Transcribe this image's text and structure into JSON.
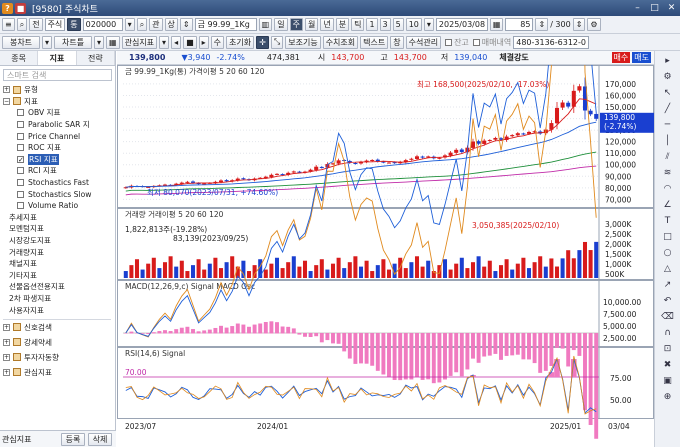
{
  "window": {
    "title": "[9580] 주식차트"
  },
  "toolbar1": {
    "jeon": "전",
    "stock_type": "주식",
    "stock_sel": "통",
    "code": "020000",
    "gwan": "관",
    "sangja": "상",
    "name": "금 99.99_1Kg",
    "il": "일",
    "ju": "주",
    "wol": "월",
    "nyeon": "년",
    "bun": "분",
    "tik": "틱",
    "n1": "1",
    "n3": "3",
    "n5": "5",
    "n10": "10",
    "date": "2025/03/08",
    "count": "85",
    "total": "/ 300"
  },
  "toolbar2": {
    "bongchart": "봉차트",
    "chartteul": "차트틀",
    "gwansim": "관심지표",
    "su": "수",
    "chogihwa": "초기화",
    "bojo": "보조기능",
    "suchi": "수치조회",
    "text": "텍스트",
    "chang": "창",
    "suseok": "수석관리",
    "jango": "잔고",
    "maemae": "매매내역",
    "account": "480-3136-6312-0"
  },
  "left": {
    "tabs": [
      "종목",
      "지표",
      "전략"
    ],
    "search_placeholder": "스마트 검색",
    "groups_top": [
      {
        "label": "유형"
      },
      {
        "label": "지표"
      }
    ],
    "indicators": [
      {
        "label": "OBV 지표",
        "checked": false
      },
      {
        "label": "Parabolic SAR 지",
        "checked": false
      },
      {
        "label": "Price Channel",
        "checked": false
      },
      {
        "label": "ROC 지표",
        "checked": false
      },
      {
        "label": "RSI 지표",
        "checked": true
      },
      {
        "label": "RCI 지표",
        "checked": false
      },
      {
        "label": "Stochastics Fast",
        "checked": false
      },
      {
        "label": "Stochastics Slow",
        "checked": false
      },
      {
        "label": "Volume Ratio",
        "checked": false
      }
    ],
    "sub_items": [
      "추세지표",
      "모멘텀지표",
      "시장강도지표",
      "거래량지표",
      "채널지표",
      "기타지표",
      "선물옵션전용지표",
      "2차 파생지표",
      "사용자지표"
    ],
    "groups_bottom": [
      "신호검색",
      "강세약세",
      "투자자동향",
      "관심지표"
    ],
    "footer": {
      "label": "관심지표",
      "add": "등록",
      "del": "삭제"
    }
  },
  "info": {
    "price": "139,800",
    "change": "▼3,940",
    "rate": "-2.74%",
    "volume": "474,381",
    "open_label": "시",
    "open": "143,700",
    "high_label": "고",
    "high": "143,700",
    "low_label": "저",
    "low": "139,040",
    "strength_label": "체결강도",
    "strength": "",
    "buy": "매수",
    "sell": "매도"
  },
  "chart_data": [
    {
      "type": "candlestick",
      "legend": "금 99.99_1Kg(통) 가격이평 5 20 60 120",
      "x": [
        "2023/07",
        "2024/01",
        "2025/01"
      ],
      "yticks": [
        170000,
        160000,
        150000,
        140000,
        130000,
        120000,
        110000,
        100000,
        90000,
        80000,
        70000
      ],
      "ylim": [
        66000,
        176000
      ],
      "max_annotation": "최고 168,500(2025/02/10, -17.03%)",
      "min_annotation": "최저 80,070(2023/07/31, +74.60%)",
      "current": "139,800",
      "current_rate": "(-2.74%)",
      "close_weekly": [
        80500,
        81800,
        81200,
        81000,
        80800,
        81500,
        82200,
        82800,
        82500,
        83600,
        84500,
        85200,
        84300,
        83300,
        83800,
        84300,
        85200,
        86400,
        85700,
        86600,
        88000,
        87700,
        86800,
        88000,
        88700,
        89600,
        91300,
        92100,
        91500,
        93000,
        94200,
        93300,
        94000,
        95700,
        98300,
        97400,
        100600,
        101200,
        103800,
        103400,
        101700,
        100800,
        102500,
        103600,
        104100,
        102900,
        102000,
        101900,
        101500,
        102500,
        104000,
        105200,
        107300,
        106200,
        107200,
        105600,
        106000,
        108100,
        110500,
        112900,
        111000,
        114800,
        120100,
        118200,
        120900,
        121400,
        123200,
        121600,
        124400,
        125700,
        127300,
        126500,
        128400,
        129000,
        127000,
        130500,
        136100,
        149200,
        153900,
        150400,
        164000,
        168000,
        147000,
        143700,
        139800
      ]
    },
    {
      "type": "bar",
      "legend": "거래량 거래이평 5 20 60 120",
      "max_annotation": "3,050,385(2025/02/10)",
      "min_annotation": "1,822,813주(-19.28%)",
      "min2_annotation": "83,139(2023/09/25)",
      "yticks": [
        "3,000K",
        "2,500K",
        "2,000K",
        "1,500K",
        "1,000K",
        "500K"
      ]
    },
    {
      "type": "line",
      "legend": "MACD(12,26,9,c) Signal MACD Osc",
      "yticks": [
        "10,000.00",
        "7,500.00",
        "5,000.00",
        "2,500.00"
      ]
    },
    {
      "type": "line",
      "legend": "RSI(14,6) Signal",
      "level": "70.00",
      "yticks": [
        "75.00",
        "50.00"
      ]
    }
  ],
  "x_footer": {
    "left": "03/04"
  },
  "colors": {
    "up": "#d81b1b",
    "down": "#1a3fd0",
    "ma5": "#d81b1b",
    "ma20": "#1e5fd8",
    "ma60": "#1e8f3a",
    "ma120": "#c02aa8"
  }
}
